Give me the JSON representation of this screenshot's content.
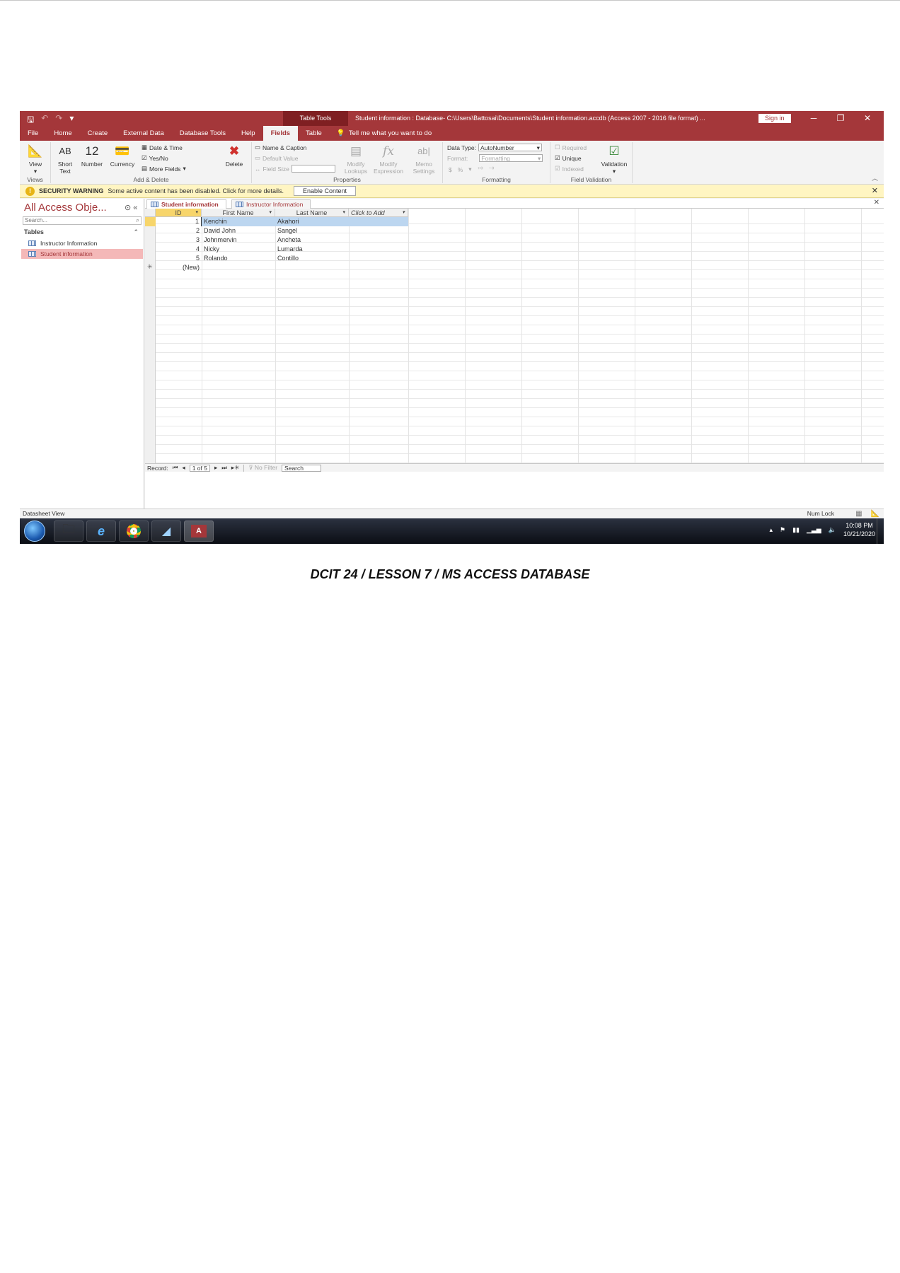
{
  "titlebar": {
    "context_tab": "Table Tools",
    "window_title": "Student information : Database- C:\\Users\\Battosai\\Documents\\Student information.accdb (Access 2007 - 2016 file format) ...",
    "sign_in": "Sign in"
  },
  "menu": {
    "tabs": [
      "File",
      "Home",
      "Create",
      "External Data",
      "Database Tools",
      "Help",
      "Fields",
      "Table"
    ],
    "active_tab": "Fields",
    "tell_me": "Tell me what you want to do"
  },
  "ribbon": {
    "views": {
      "view_label": "View",
      "group_label": "Views"
    },
    "add_delete": {
      "short_text_icon": "AB",
      "short_text": "Short Text",
      "number_icon": "12",
      "number": "Number",
      "currency": "Currency",
      "date_time": "Date & Time",
      "yes_no": "Yes/No",
      "more_fields": "More Fields",
      "delete": "Delete",
      "group_label": "Add & Delete"
    },
    "properties": {
      "name_caption": "Name & Caption",
      "default_value": "Default Value",
      "field_size": "Field Size",
      "modify_lookups": "Modify Lookups",
      "modify_expression": "Modify Expression",
      "memo_settings": "Memo Settings",
      "group_label": "Properties"
    },
    "formatting": {
      "data_type_label": "Data Type:",
      "data_type_value": "AutoNumber",
      "format_label": "Format:",
      "format_value": "Formatting",
      "currency_sym": "$",
      "percent_sym": "%",
      "group_label": "Formatting"
    },
    "field_validation": {
      "required": "Required",
      "unique": "Unique",
      "indexed": "Indexed",
      "validation": "Validation",
      "group_label": "Field Validation"
    }
  },
  "security_bar": {
    "title": "SECURITY WARNING",
    "message": "Some active content has been disabled. Click for more details.",
    "button": "Enable Content"
  },
  "nav_pane": {
    "title": "All Access Obje...",
    "search_placeholder": "Search...",
    "group": "Tables",
    "items": [
      "Instructor Information",
      "Student information"
    ],
    "selected_index": 1
  },
  "document_tabs": [
    "Student information",
    "Instructor Information"
  ],
  "datasheet": {
    "columns": [
      "ID",
      "First Name",
      "Last Name",
      "Click to Add"
    ],
    "rows": [
      {
        "id": "1",
        "first": "Kenchin",
        "last": "Akahori"
      },
      {
        "id": "2",
        "first": "David John",
        "last": "Sangel"
      },
      {
        "id": "3",
        "first": "Johnmervin",
        "last": "Ancheta"
      },
      {
        "id": "4",
        "first": "Nicky",
        "last": "Lumarda"
      },
      {
        "id": "5",
        "first": "Rolando",
        "last": "Contillo"
      }
    ],
    "new_row_label": "(New)"
  },
  "record_nav": {
    "label": "Record:",
    "position": "1 of 5",
    "filter": "No Filter",
    "search": "Search"
  },
  "status_bar": {
    "view": "Datasheet View",
    "num_lock": "Num Lock"
  },
  "taskbar": {
    "time": "10:08 PM",
    "date": "10/21/2020"
  },
  "caption": "DCIT 24 / LESSON 7 / MS ACCESS DATABASE"
}
